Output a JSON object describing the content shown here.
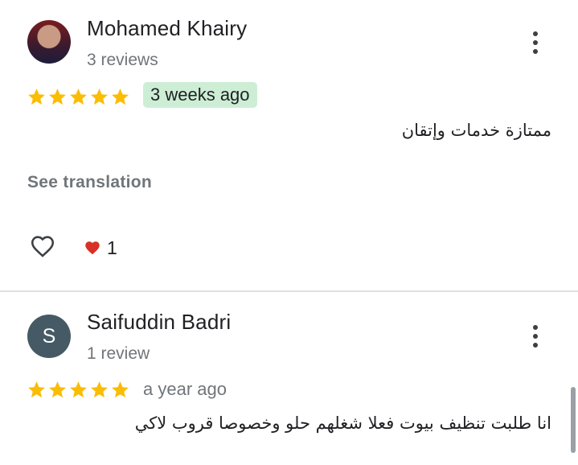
{
  "reviews": [
    {
      "author": "Mohamed Khairy",
      "review_count": "3 reviews",
      "rating": 5,
      "time": "3 weeks ago",
      "text": "ممتازة خدمات وإتقان",
      "see_translation": "See translation",
      "likes": "1"
    },
    {
      "author": "Saifuddin Badri",
      "avatar_letter": "S",
      "review_count": "1 review",
      "rating": 5,
      "time": "a year ago",
      "text": "انا طلبت تنظيف بيوت فعلا شغلهم حلو وخصوصا  قروب لاكي"
    }
  ],
  "colors": {
    "star": "#fbbc04",
    "badge_bg": "#cdeed5",
    "heart_red": "#d93025",
    "secondary_text": "#70757a"
  }
}
